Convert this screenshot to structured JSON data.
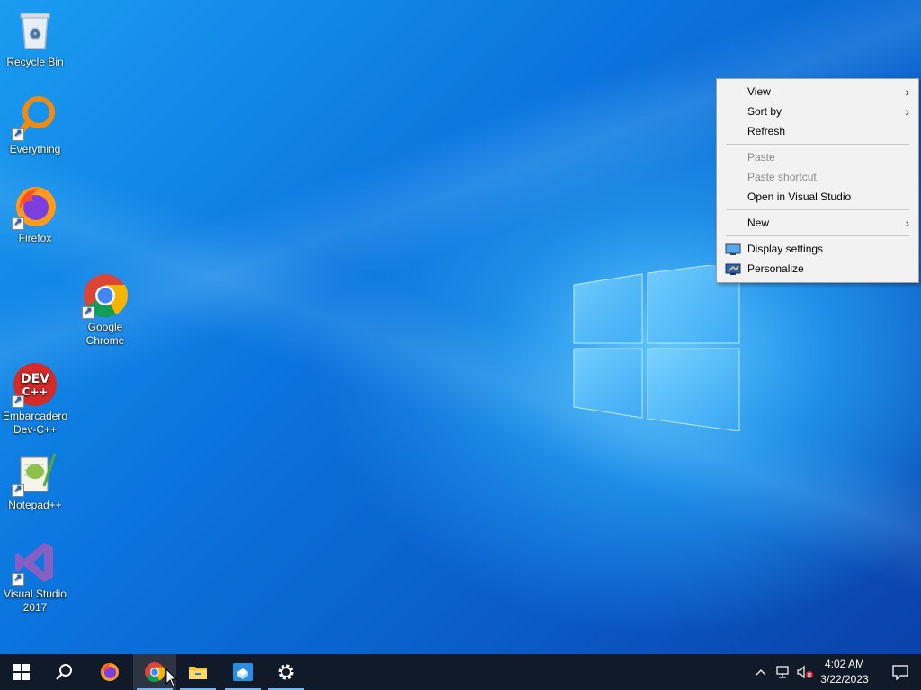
{
  "desktop": {
    "icons": [
      {
        "id": "recycle-bin",
        "label": "Recycle Bin"
      },
      {
        "id": "everything",
        "label": "Everything"
      },
      {
        "id": "firefox",
        "label": "Firefox"
      },
      {
        "id": "google-chrome",
        "label": "Google Chrome"
      },
      {
        "id": "devcpp",
        "label": "Embarcadero Dev-C++"
      },
      {
        "id": "notepadpp",
        "label": "Notepad++"
      },
      {
        "id": "visual-studio",
        "label": "Visual Studio 2017"
      }
    ]
  },
  "context_menu": {
    "view": "View",
    "sort_by": "Sort by",
    "refresh": "Refresh",
    "paste": "Paste",
    "paste_shortcut": "Paste shortcut",
    "open_vs": "Open in Visual Studio",
    "new": "New",
    "display_settings": "Display settings",
    "personalize": "Personalize",
    "devcpp_logo_text": "DEV C++"
  },
  "taskbar": {
    "clock_time": "4:02 AM",
    "clock_date": "3/22/2023",
    "pinned": [
      "start-icon",
      "search-icon",
      "firefox-icon",
      "chrome-icon",
      "file-explorer-icon",
      "sandbox-icon",
      "settings-icon"
    ]
  },
  "colors": {
    "accent": "#0b74de",
    "taskbar": "#101a28",
    "menu_bg": "#f2f2f2"
  }
}
